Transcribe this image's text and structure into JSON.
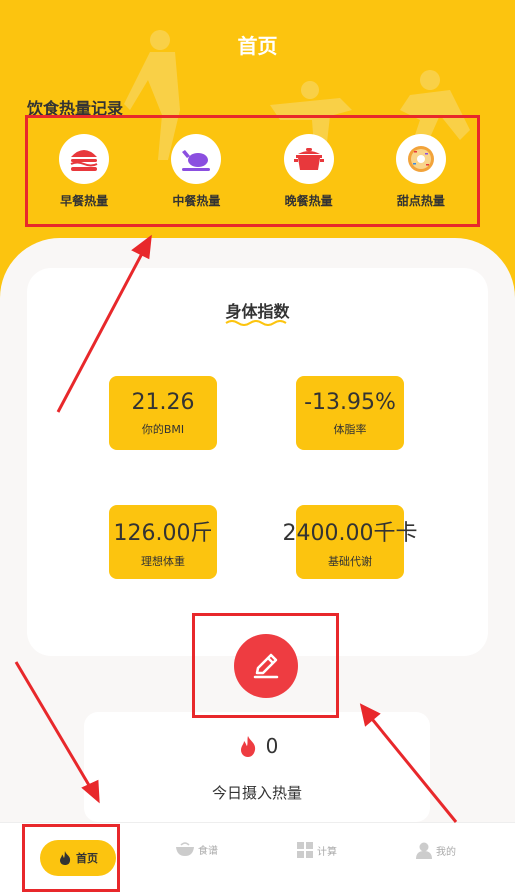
{
  "header": {
    "title": "首页",
    "section_title": "饮食热量记录"
  },
  "meals": [
    {
      "label": "早餐热量",
      "icon": "burger-icon"
    },
    {
      "label": "中餐热量",
      "icon": "roast-chicken-icon"
    },
    {
      "label": "晚餐热量",
      "icon": "cooking-pot-icon"
    },
    {
      "label": "甜点热量",
      "icon": "donut-icon"
    }
  ],
  "body_index": {
    "title": "身体指数",
    "bmi": {
      "value": "21.26",
      "label": "你的BMI"
    },
    "body_fat": {
      "value": "-13.95%",
      "label": "体脂率"
    },
    "ideal_weight": {
      "value": "126.00斤",
      "label": "理想体重"
    },
    "bmr": {
      "value": "2400.00千卡",
      "label": "基础代谢"
    }
  },
  "intake": {
    "value": "0",
    "label": "今日摄入热量"
  },
  "tabbar": {
    "home": "首页",
    "food": "食谱",
    "calc": "计算",
    "mine": "我的"
  },
  "colors": {
    "brand_yellow": "#fcc40f",
    "accent_red": "#ee3c41",
    "annotation_red": "#e8282b"
  }
}
